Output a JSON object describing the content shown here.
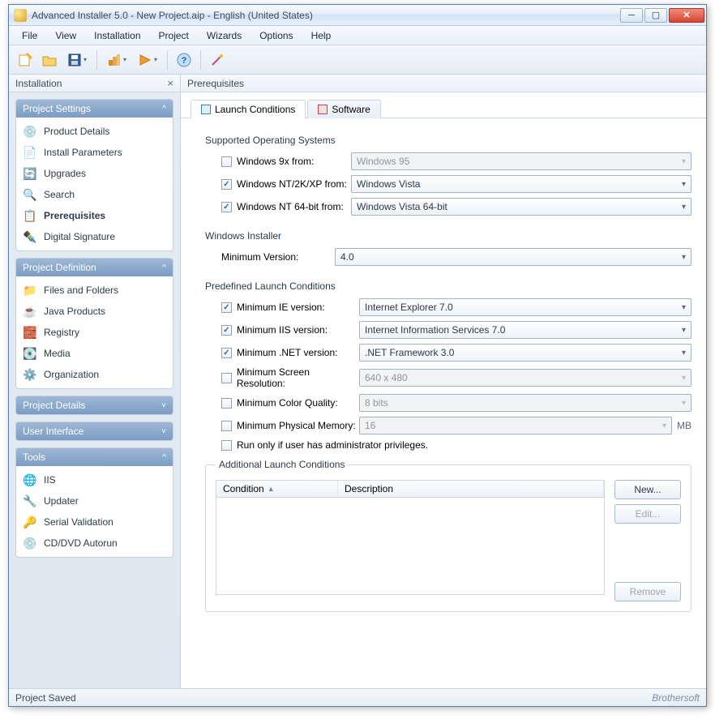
{
  "window": {
    "title": "Advanced Installer 5.0 - New Project.aip - English (United States)"
  },
  "menubar": [
    "File",
    "View",
    "Installation",
    "Project",
    "Wizards",
    "Options",
    "Help"
  ],
  "left_header": "Installation",
  "right_header": "Prerequisites",
  "sidebar": {
    "groups": [
      {
        "title": "Project Settings",
        "collapsed": false,
        "items": [
          {
            "label": "Product Details",
            "icon": "💿",
            "name": "product-details"
          },
          {
            "label": "Install Parameters",
            "icon": "📄",
            "name": "install-parameters"
          },
          {
            "label": "Upgrades",
            "icon": "🔄",
            "name": "upgrades"
          },
          {
            "label": "Search",
            "icon": "🔍",
            "name": "search"
          },
          {
            "label": "Prerequisites",
            "icon": "📋",
            "name": "prerequisites",
            "active": true
          },
          {
            "label": "Digital Signature",
            "icon": "✒️",
            "name": "digital-signature"
          }
        ]
      },
      {
        "title": "Project Definition",
        "collapsed": false,
        "items": [
          {
            "label": "Files and Folders",
            "icon": "📁",
            "name": "files-folders"
          },
          {
            "label": "Java Products",
            "icon": "☕",
            "name": "java-products"
          },
          {
            "label": "Registry",
            "icon": "🧱",
            "name": "registry"
          },
          {
            "label": "Media",
            "icon": "💽",
            "name": "media"
          },
          {
            "label": "Organization",
            "icon": "⚙️",
            "name": "organization"
          }
        ]
      },
      {
        "title": "Project Details",
        "collapsed": true,
        "items": []
      },
      {
        "title": "User Interface",
        "collapsed": true,
        "items": []
      },
      {
        "title": "Tools",
        "collapsed": false,
        "items": [
          {
            "label": "IIS",
            "icon": "🌐",
            "name": "iis"
          },
          {
            "label": "Updater",
            "icon": "🔧",
            "name": "updater"
          },
          {
            "label": "Serial Validation",
            "icon": "🔑",
            "name": "serial-validation"
          },
          {
            "label": "CD/DVD Autorun",
            "icon": "💿",
            "name": "cd-dvd-autorun"
          }
        ]
      }
    ]
  },
  "tabs": [
    {
      "label": "Launch Conditions",
      "active": true
    },
    {
      "label": "Software",
      "active": false
    }
  ],
  "sections": {
    "os": {
      "title": "Supported Operating Systems",
      "rows": [
        {
          "check": false,
          "label": "Windows 9x from:",
          "value": "Windows 95",
          "disabled": true
        },
        {
          "check": true,
          "label": "Windows NT/2K/XP from:",
          "value": "Windows Vista",
          "disabled": false
        },
        {
          "check": true,
          "label": "Windows NT 64-bit from:",
          "value": "Windows Vista 64-bit",
          "disabled": false
        }
      ]
    },
    "wi": {
      "title": "Windows Installer",
      "label": "Minimum Version:",
      "value": "4.0"
    },
    "pre": {
      "title": "Predefined Launch Conditions",
      "rows": [
        {
          "check": true,
          "label": "Minimum IE version:",
          "value": "Internet Explorer 7.0",
          "disabled": false
        },
        {
          "check": true,
          "label": "Minimum IIS version:",
          "value": "Internet Information Services 7.0",
          "disabled": false
        },
        {
          "check": true,
          "label": "Minimum .NET version:",
          "value": ".NET Framework 3.0",
          "disabled": false
        },
        {
          "check": false,
          "label": "Minimum Screen Resolution:",
          "value": "640 x 480",
          "disabled": true
        },
        {
          "check": false,
          "label": "Minimum Color Quality:",
          "value": "8 bits",
          "disabled": true
        },
        {
          "check": false,
          "label": "Minimum Physical Memory:",
          "value": "16",
          "disabled": true,
          "unit": "MB"
        }
      ],
      "admin_label": "Run only if user has administrator privileges."
    },
    "addl": {
      "title": "Additional Launch Conditions",
      "cols": [
        "Condition",
        "Description"
      ],
      "buttons": {
        "new": "New...",
        "edit": "Edit...",
        "remove": "Remove"
      }
    }
  },
  "status": "Project Saved",
  "brand": "Brothersoft"
}
